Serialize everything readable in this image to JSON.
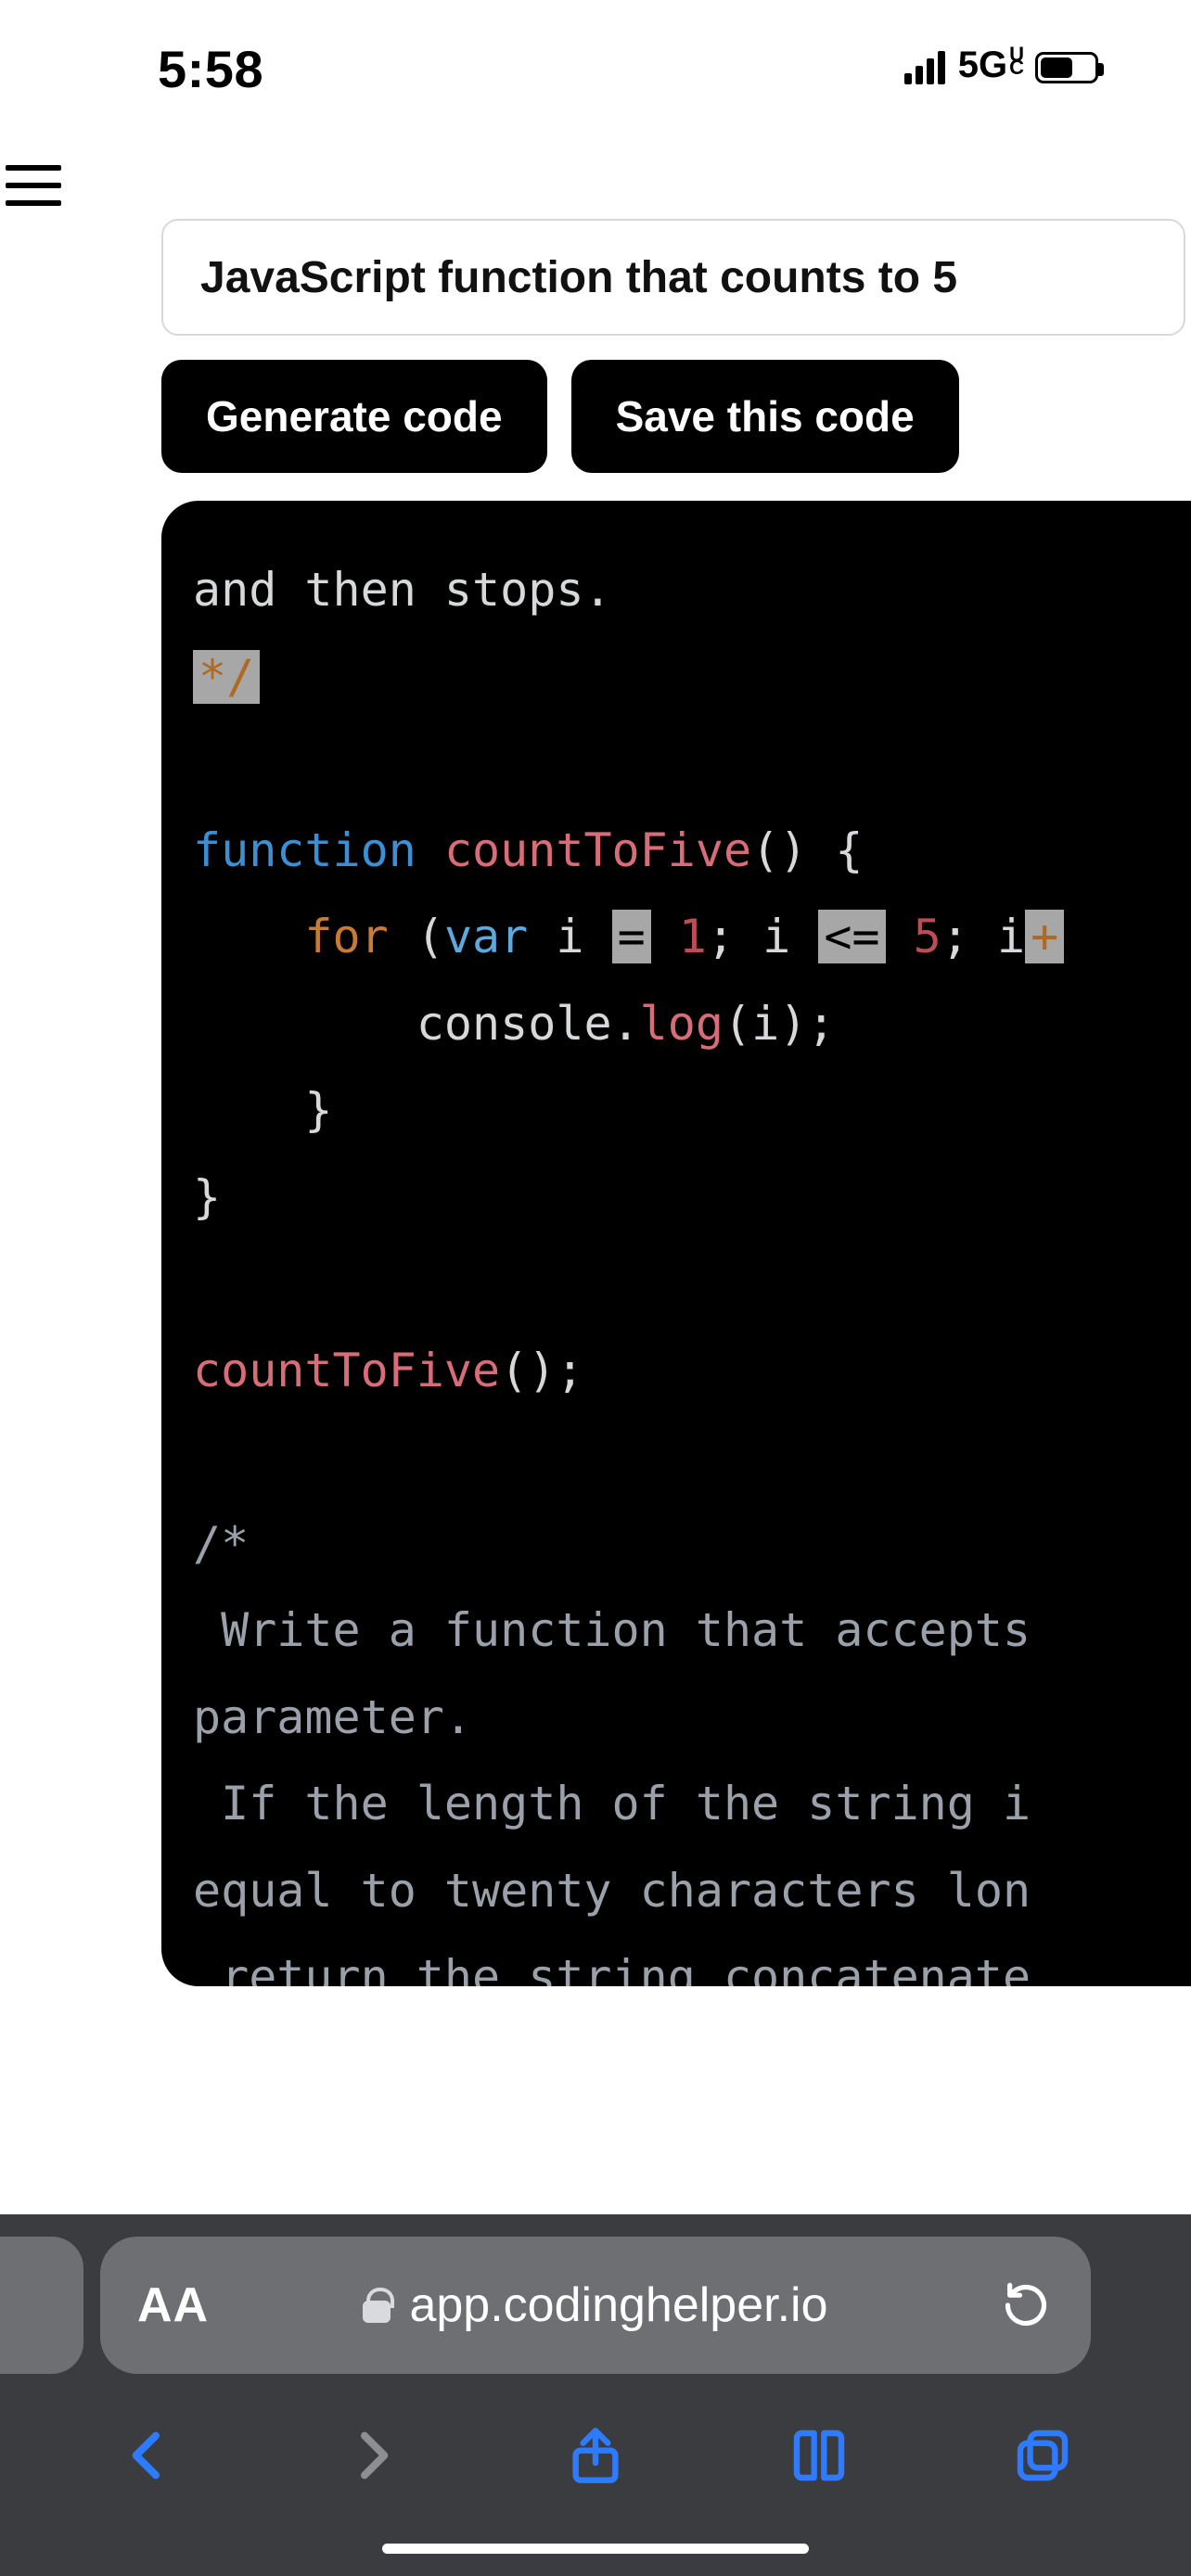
{
  "status": {
    "time": "5:58",
    "network": "5G",
    "network_badge": "U\nC"
  },
  "page": {
    "prompt": "JavaScript function that counts to 5",
    "buttons": {
      "generate": "Generate code",
      "save": "Save this code"
    }
  },
  "code": {
    "line1_text": "and then stops.",
    "comment_end": "*/",
    "kw_function": "function",
    "fn_name": "countToFive",
    "paren_open_brace": "() {",
    "kw_for": "for",
    "paren_open": " (",
    "kw_var": "var",
    "var_i": " i ",
    "op_assign": "=",
    "num_1": " 1",
    "semi1": "; i ",
    "op_lte": "<=",
    "num_5": " 5",
    "semi2": "; i",
    "op_inc": "+",
    "console": "console",
    "dot": ".",
    "log": "log",
    "log_arg": "(i);",
    "brace_close_inner": "}",
    "brace_close_outer": "}",
    "call": "countToFive",
    "call_tail": "();",
    "c2_open": "/*",
    "c2_l1": " Write a function that accepts",
    "c2_l2": "parameter.",
    "c2_l3": " If the length of the string i",
    "c2_l4": "equal to twenty characters lon",
    "c2_l5": " return the string concatenate"
  },
  "browser": {
    "aa": "AA",
    "domain": "app.codinghelper.io"
  }
}
